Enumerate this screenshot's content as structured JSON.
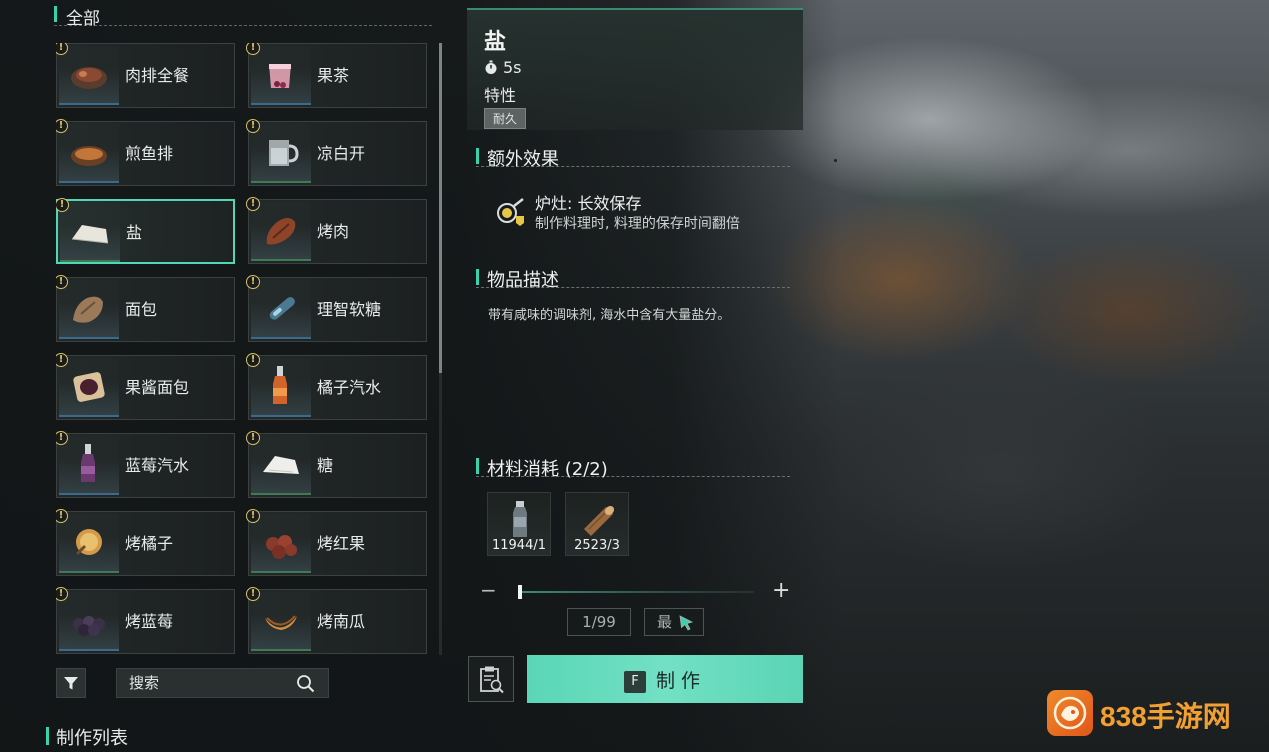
{
  "category": {
    "title": "全部"
  },
  "items": [
    {
      "name": "肉排全餐",
      "badge": "!",
      "icon": "steak-meal-icon",
      "selected": false
    },
    {
      "name": "果茶",
      "badge": "!",
      "icon": "fruit-tea-icon",
      "selected": false
    },
    {
      "name": "煎鱼排",
      "badge": "!",
      "icon": "fried-fish-icon",
      "selected": false
    },
    {
      "name": "凉白开",
      "badge": "!",
      "icon": "water-mug-icon",
      "selected": false
    },
    {
      "name": "盐",
      "badge": "!",
      "icon": "salt-icon",
      "selected": true
    },
    {
      "name": "烤肉",
      "badge": "!",
      "icon": "roast-meat-icon",
      "selected": false
    },
    {
      "name": "面包",
      "badge": "!",
      "icon": "bread-icon",
      "selected": false
    },
    {
      "name": "理智软糖",
      "badge": "!",
      "icon": "sanity-candy-icon",
      "selected": false
    },
    {
      "name": "果酱面包",
      "badge": "!",
      "icon": "jam-bread-icon",
      "selected": false
    },
    {
      "name": "橘子汽水",
      "badge": "!",
      "icon": "orange-soda-icon",
      "selected": false
    },
    {
      "name": "蓝莓汽水",
      "badge": "!",
      "icon": "blueberry-soda-icon",
      "selected": false
    },
    {
      "name": "糖",
      "badge": "!",
      "icon": "sugar-icon",
      "selected": false
    },
    {
      "name": "烤橘子",
      "badge": "!",
      "icon": "roast-orange-icon",
      "selected": false
    },
    {
      "name": "烤红果",
      "badge": "!",
      "icon": "roast-red-fruit-icon",
      "selected": false
    },
    {
      "name": "烤蓝莓",
      "badge": "!",
      "icon": "roast-blueberry-icon",
      "selected": false
    },
    {
      "name": "烤南瓜",
      "badge": "!",
      "icon": "roast-pumpkin-icon",
      "selected": false
    }
  ],
  "search": {
    "placeholder": "搜索"
  },
  "craft_list": {
    "title": "制作列表"
  },
  "detail": {
    "name": "盐",
    "time": "5s",
    "trait_label": "特性",
    "trait_tag": "耐久",
    "extra_effect": {
      "heading": "额外效果",
      "title": "炉灶: 长效保存",
      "desc": "制作料理时, 料理的保存时间翻倍"
    },
    "description": {
      "heading": "物品描述",
      "text": "带有咸味的调味剂, 海水中含有大量盐分。"
    },
    "materials": {
      "heading": "材料消耗 (2/2)",
      "list": [
        {
          "count": "11944/1",
          "icon": "water-bottle-icon"
        },
        {
          "count": "2523/3",
          "icon": "wood-log-icon"
        }
      ]
    },
    "quantity": {
      "minus": "−",
      "plus": "+",
      "value": "1/99",
      "max_label": "最",
      "level": 0.01
    },
    "craft_button": {
      "key": "F",
      "label": "制作"
    }
  },
  "watermark": {
    "text": "838手游网"
  },
  "colors": {
    "accent": "#38d3ad",
    "selected_border": "#4fd7b6",
    "craft_button": "#66dbbd",
    "badge": "#d8c36b",
    "watermark": "#f3a032"
  }
}
